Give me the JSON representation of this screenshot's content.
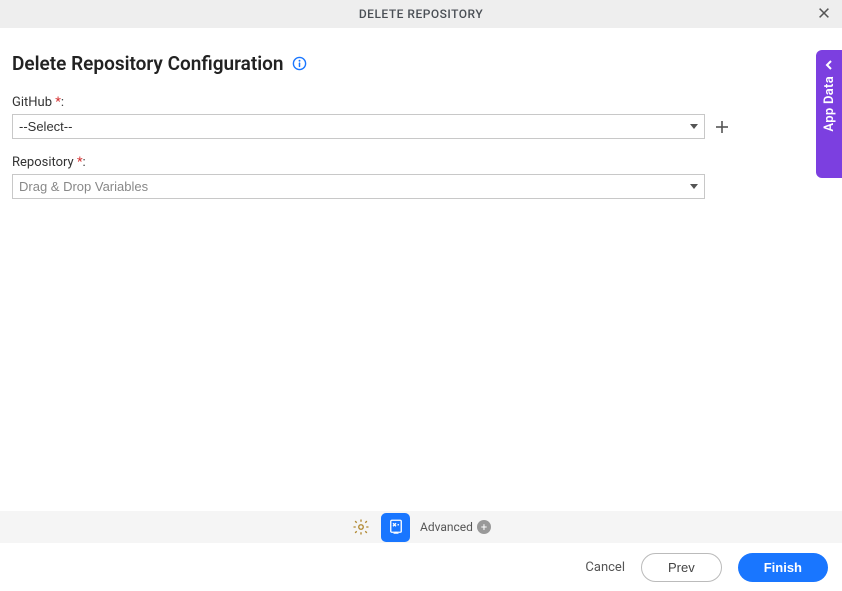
{
  "header": {
    "title": "DELETE REPOSITORY"
  },
  "page": {
    "title": "Delete Repository Configuration"
  },
  "form": {
    "github": {
      "label": "GitHub ",
      "required": "*",
      "colon": ":",
      "selected": "--Select--"
    },
    "repository": {
      "label": "Repository ",
      "required": "*",
      "colon": ":",
      "placeholder": "Drag & Drop Variables"
    }
  },
  "sidebar": {
    "app_data_label": "App Data"
  },
  "toolbar": {
    "advanced_label": "Advanced"
  },
  "footer": {
    "cancel": "Cancel",
    "prev": "Prev",
    "finish": "Finish"
  }
}
